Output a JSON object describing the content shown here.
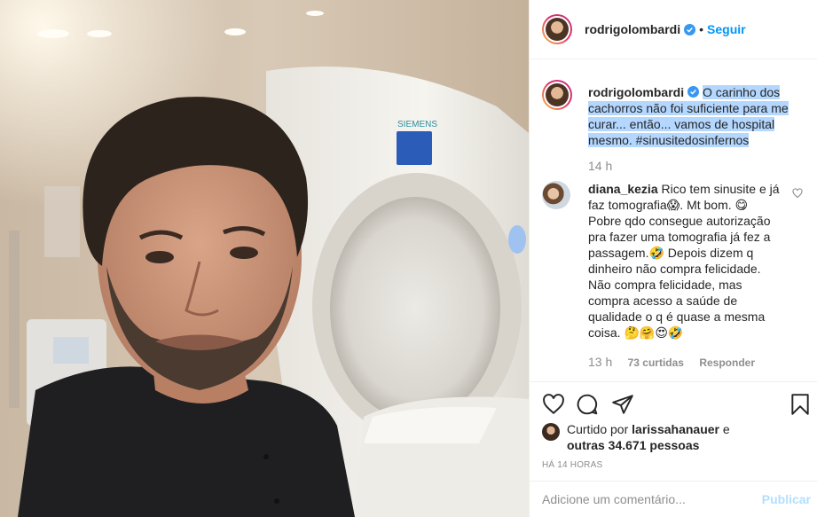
{
  "post": {
    "author": "rodrigolombardi",
    "follow_label": "Seguir",
    "dot": "•",
    "caption_author": "rodrigolombardi",
    "caption_text": "O carinho dos cachorros não foi suficiente para me curar... então... vamos de hospital mesmo. #sinusitedosinfernos",
    "caption_time": "14 h",
    "image_label": "SIEMENS"
  },
  "comments": [
    {
      "user": "diana_kezia",
      "text": "Rico tem sinusite e já faz tomografia😱. Mt bom. 😋 Pobre qdo consegue autorização pra fazer uma tomografia já fez a passagem.🤣 Depois dizem q dinheiro não compra felicidade. Não compra felicidade, mas compra acesso a saúde de qualidade o q é quase a mesma coisa. 🤔🤗😍🤣",
      "time": "13 h",
      "likes": "73 curtidas",
      "reply_label": "Responder"
    }
  ],
  "likes": {
    "prefix": "Curtido por",
    "user": "larissahanauer",
    "middle": "e",
    "others": "outras 34.671 pessoas"
  },
  "posted_ago": "HÁ 14 HORAS",
  "comment_box": {
    "placeholder": "Adicione um comentário...",
    "publish_label": "Publicar"
  },
  "colors": {
    "accent": "#0095f6",
    "muted": "#8e8e8e",
    "highlight": "#b4d7ff",
    "publish_disabled": "#b2dffc"
  },
  "icons": [
    "verified-icon",
    "heart-icon",
    "comment-icon",
    "share-icon",
    "bookmark-icon",
    "heart-small-icon"
  ]
}
